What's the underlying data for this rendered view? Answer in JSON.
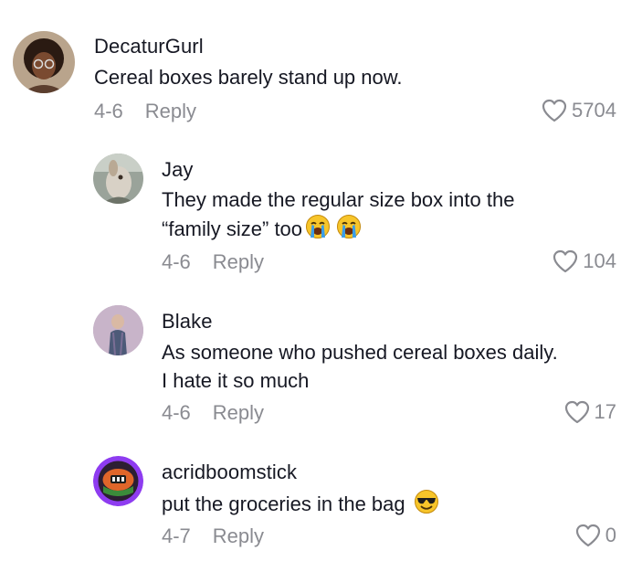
{
  "comments": [
    {
      "username": "DecaturGurl",
      "text_lines": [
        "Cereal boxes barely stand up now."
      ],
      "date": "4-6",
      "reply_label": "Reply",
      "likes": "5704",
      "avatar": "profile-photo-woman-glasses"
    },
    {
      "username": "Jay",
      "text_lines": [
        "They made the regular size box into the",
        "“family size” too"
      ],
      "emojis": [
        "loudly-crying-face",
        "loudly-crying-face"
      ],
      "date": "4-6",
      "reply_label": "Reply",
      "likes": "104",
      "avatar": "profile-photo-animal"
    },
    {
      "username": "Blake",
      "text_lines": [
        "As someone who pushed cereal boxes daily.",
        "I hate it so much"
      ],
      "date": "4-6",
      "reply_label": "Reply",
      "likes": "17",
      "avatar": "profile-photo-person"
    },
    {
      "username": "acridboomstick",
      "text_lines": [
        "put the groceries in the bag"
      ],
      "emojis": [
        "smiling-face-with-sunglasses"
      ],
      "date": "4-7",
      "reply_label": "Reply",
      "likes": "0",
      "avatar": "profile-photo-cartoon-purple-ring"
    }
  ],
  "colors": {
    "text": "#161823",
    "meta": "#8a8b91",
    "avatar_ring": "#8e3cf0"
  }
}
